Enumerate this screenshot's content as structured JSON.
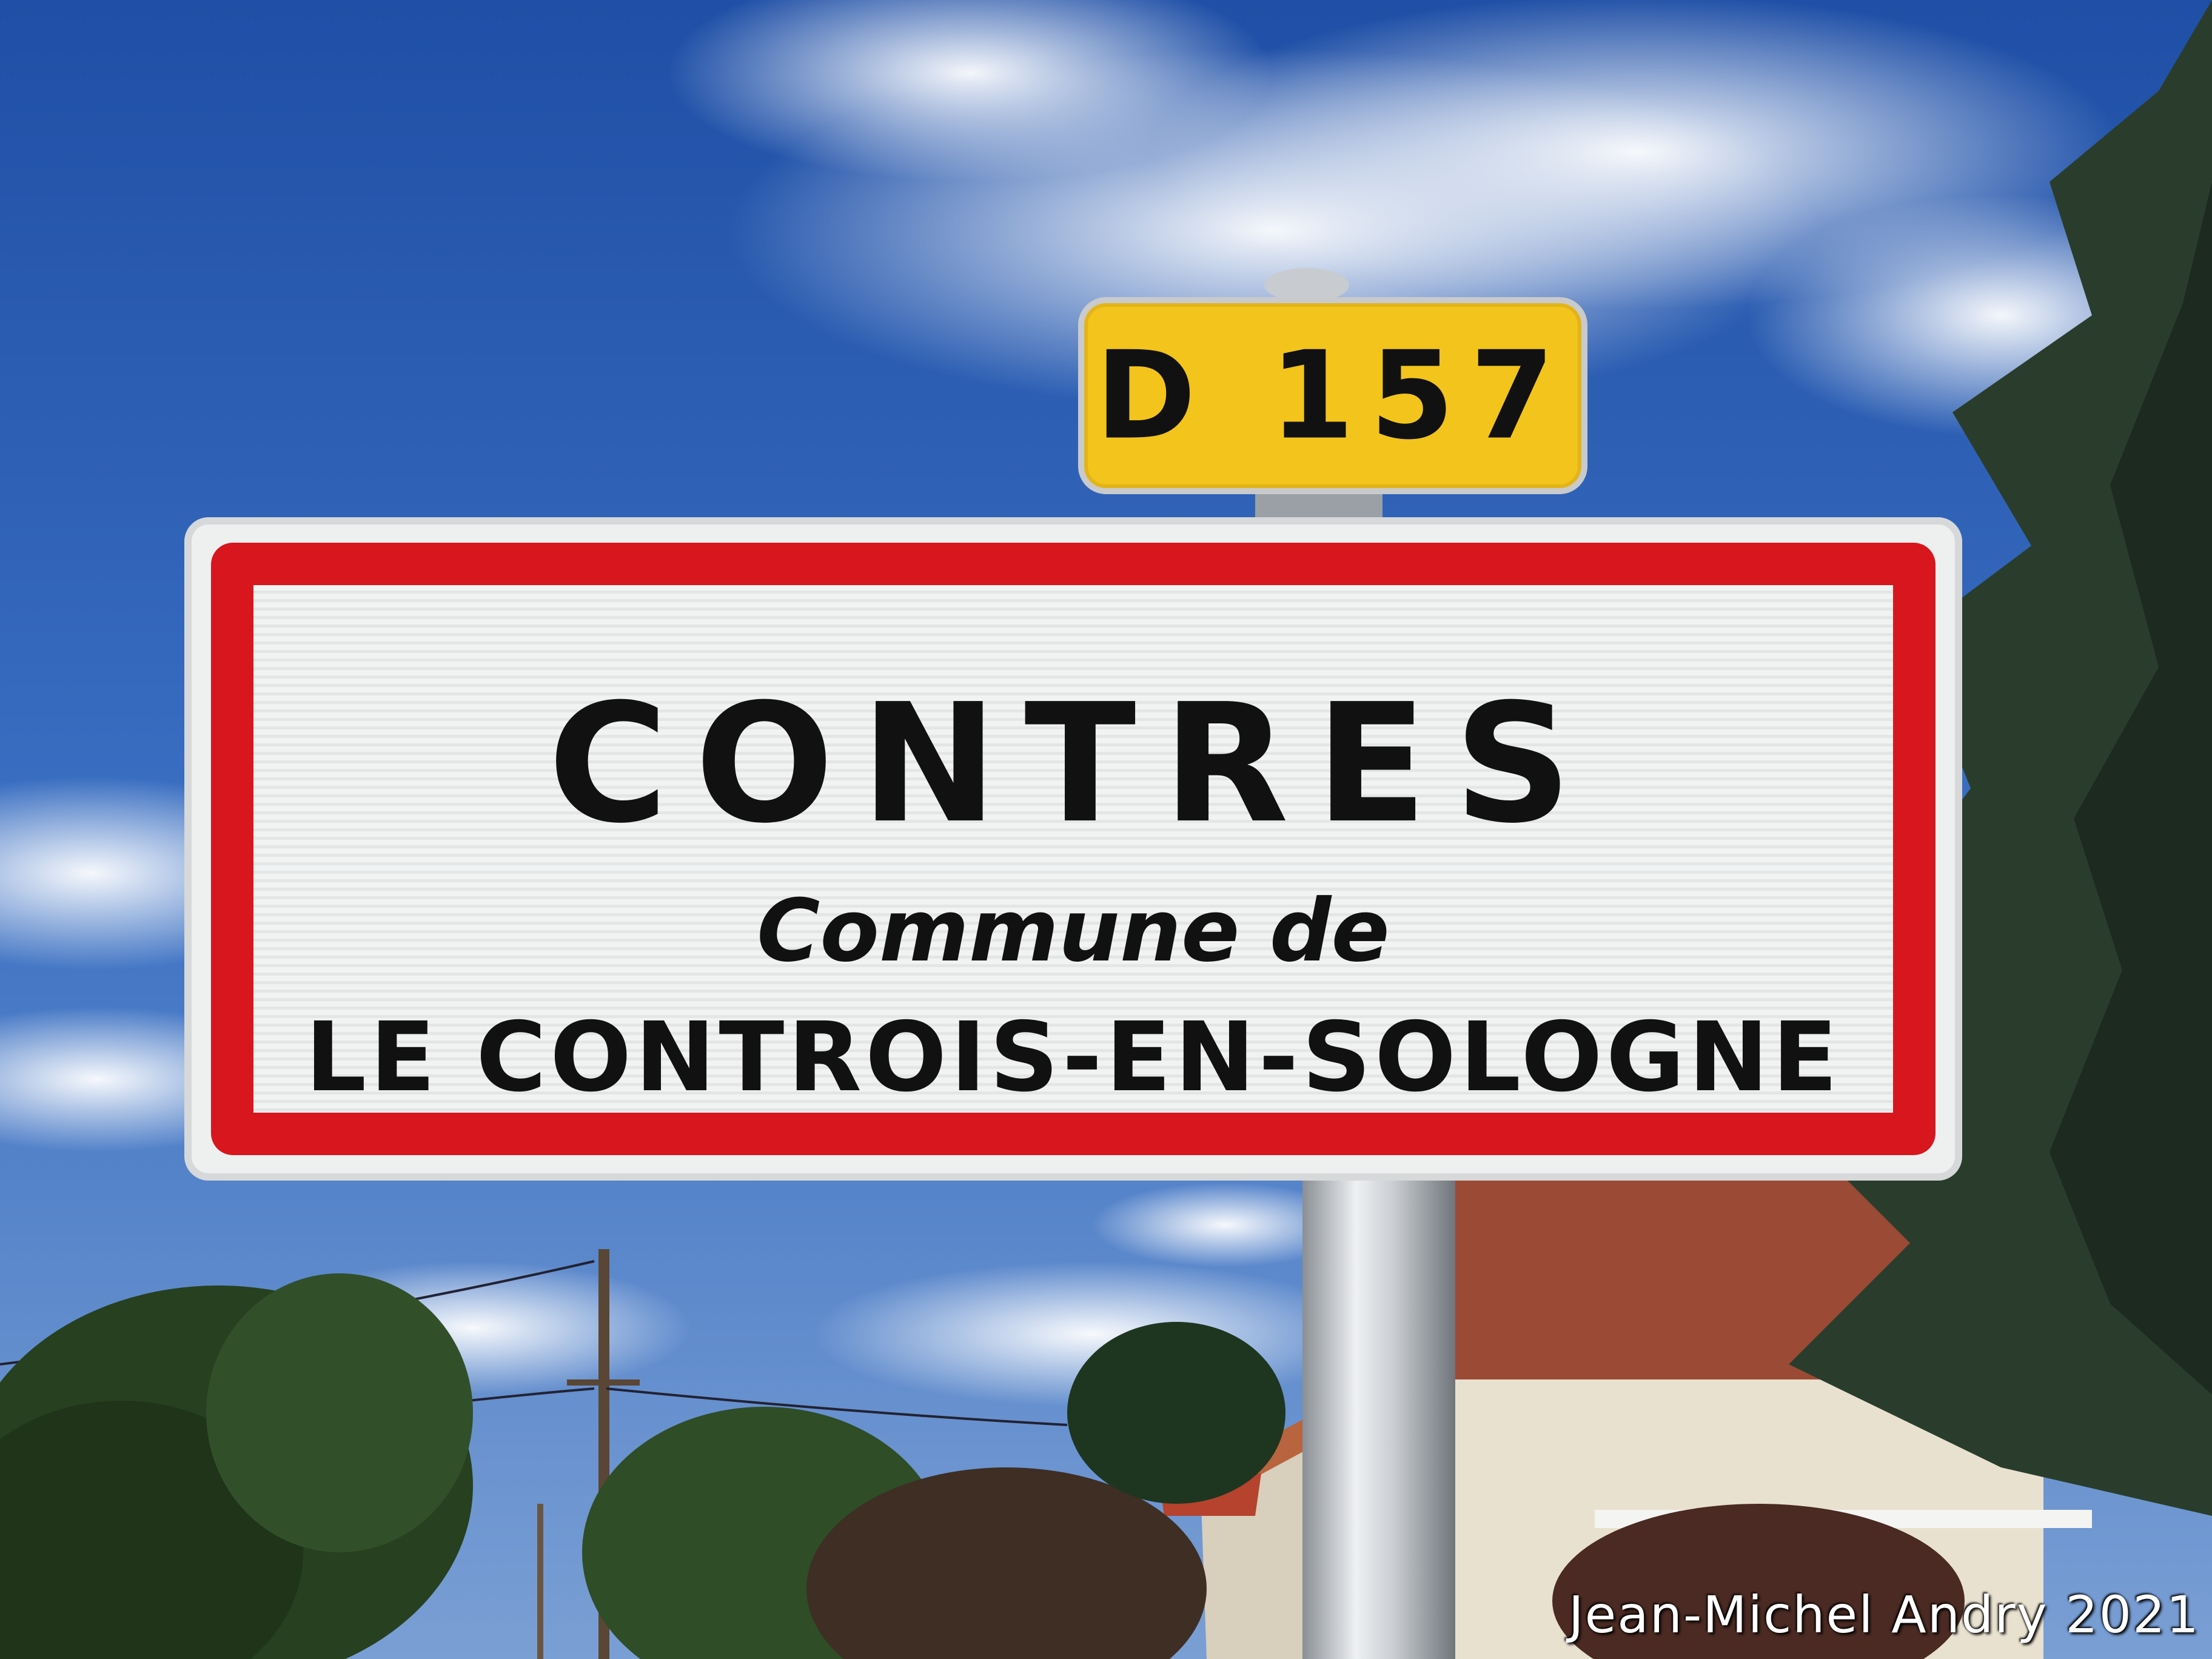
{
  "photo": {
    "route_plate": {
      "text": "D 157"
    },
    "town_sign": {
      "town": "CONTRES",
      "commune_prefix": "Commune de",
      "commune_name": "LE CONTROIS-EN-SOLOGNE"
    },
    "watermark": "Jean-Michel Andry 2021"
  },
  "colors": {
    "sky": "#2f62b8",
    "sign_border_red": "#d8161e",
    "route_plate_yellow": "#f2c41c"
  }
}
